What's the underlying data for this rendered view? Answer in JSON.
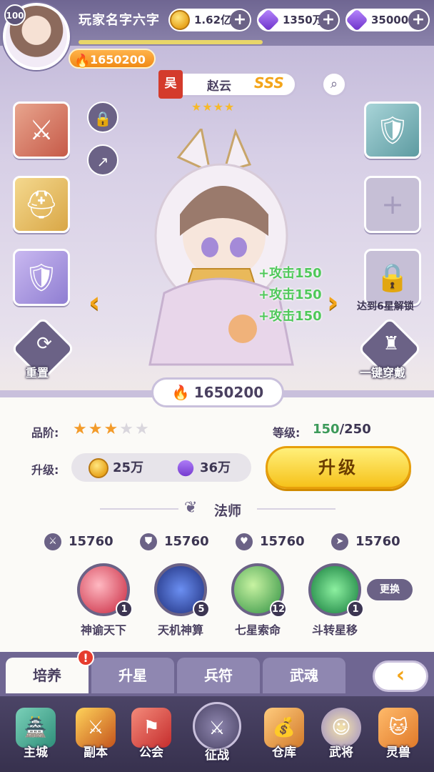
{
  "player": {
    "level": "100",
    "name": "玩家名字六字",
    "power": "1650200"
  },
  "resources": {
    "gold": "1.62亿",
    "gems": "1350万",
    "crystals": "35000"
  },
  "hero": {
    "faction": "吴",
    "name": "赵云",
    "rank": "SSS",
    "stars": "★★★★",
    "power": "1650200",
    "grade_stars_on": 3,
    "grade_stars_total": 5
  },
  "slots": {
    "unlock_tip": "达到6星解锁"
  },
  "buffs": [
    "+攻击150",
    "+攻击150",
    "+攻击150"
  ],
  "actions": {
    "reset": "重置",
    "equip_all": "一键穿戴"
  },
  "panel": {
    "grade_label": "品阶:",
    "level_label": "等级:",
    "level_current": "150",
    "level_max": "/250",
    "upgrade_label": "升级:",
    "cost_gold": "25万",
    "cost_gems": "36万",
    "upgrade_button": "升级",
    "class_name": "法师"
  },
  "stats": {
    "attack": "15760",
    "defense": "15760",
    "hp": "15760",
    "speed": "15760"
  },
  "skills": [
    {
      "name": "神谕天下",
      "level": "1"
    },
    {
      "name": "天机神算",
      "level": "5"
    },
    {
      "name": "七星索命",
      "level": "12"
    },
    {
      "name": "斗转星移",
      "level": "1"
    }
  ],
  "swap_button": "更换",
  "tabs": [
    "培养",
    "升星",
    "兵符",
    "武魂"
  ],
  "tab_alert": "!",
  "nav": [
    "主城",
    "副本",
    "公会",
    "征战",
    "仓库",
    "武将",
    "灵兽"
  ],
  "colors": {
    "accent": "#f3a51a",
    "panel_purple": "#6b6286",
    "buff_green": "#4fc85a",
    "level_green": "#3c9a5a"
  }
}
